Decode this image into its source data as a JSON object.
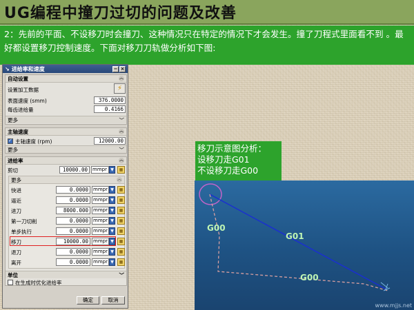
{
  "slide": {
    "title": "UG编程中撞刀过切的问题及改善",
    "note": "2：先前的平面、不设移刀时会撞刀、这种情况只在特定的情况下才会发生。撞了刀程式里面看不到 。最好都设置移刀控制速度。下面对移刀刀轨做分析如下图:"
  },
  "dialog": {
    "title": "进给率和速度",
    "auto": {
      "header": "自动设置",
      "set_label": "设置加工数据",
      "surface_speed_label": "表面速度 (smm)",
      "surface_speed_value": "376.0000",
      "feed_per_tooth_label": "每齿进给量",
      "feed_per_tooth_value": "0.4166",
      "more": "更多"
    },
    "spindle": {
      "header": "主轴速度",
      "checked": true,
      "label": "主轴速度 (rpm)",
      "value": "12000.00",
      "more": "更多"
    },
    "feed": {
      "header": "进给率",
      "cut_label": "剪切",
      "cut_value": "10000.00",
      "cut_unit": "mmpr",
      "more_header": "更多",
      "rows": [
        {
          "label": "快进",
          "value": "0.0000",
          "unit": "mmpr"
        },
        {
          "label": "逼近",
          "value": "0.0000",
          "unit": "mmpr"
        },
        {
          "label": "进刀",
          "value": "8000.000",
          "unit": "mmpr"
        },
        {
          "label": "第一刀切削",
          "value": "0.0000",
          "unit": "mmpr"
        },
        {
          "label": "单步执行",
          "value": "0.0000",
          "unit": "mmpr"
        },
        {
          "label": "移刀",
          "value": "10000.00",
          "unit": "mmpr"
        },
        {
          "label": "退刀",
          "value": "0.0000",
          "unit": "mmpr"
        },
        {
          "label": "离开",
          "value": "0.0000",
          "unit": "mmpr"
        }
      ],
      "units_header": "单位",
      "optimize_label": "在生成时优化进给率"
    },
    "ok": "确定",
    "cancel": "取消"
  },
  "info": {
    "line1": "移刀示意图分析：",
    "line2": "设移刀走G01",
    "line3": "不设移刀走G00"
  },
  "scene": {
    "label_g00_left": "G00",
    "label_g01": "G01",
    "label_g00_bottom": "G00",
    "watermark": "www.mjjs.net"
  },
  "colors": {
    "header_bg": "#8aa55d",
    "note_bg": "#2da32c",
    "g01_line": "#1a2fd0",
    "g00_line": "#d9a0a0",
    "circle": "#c264c8"
  }
}
